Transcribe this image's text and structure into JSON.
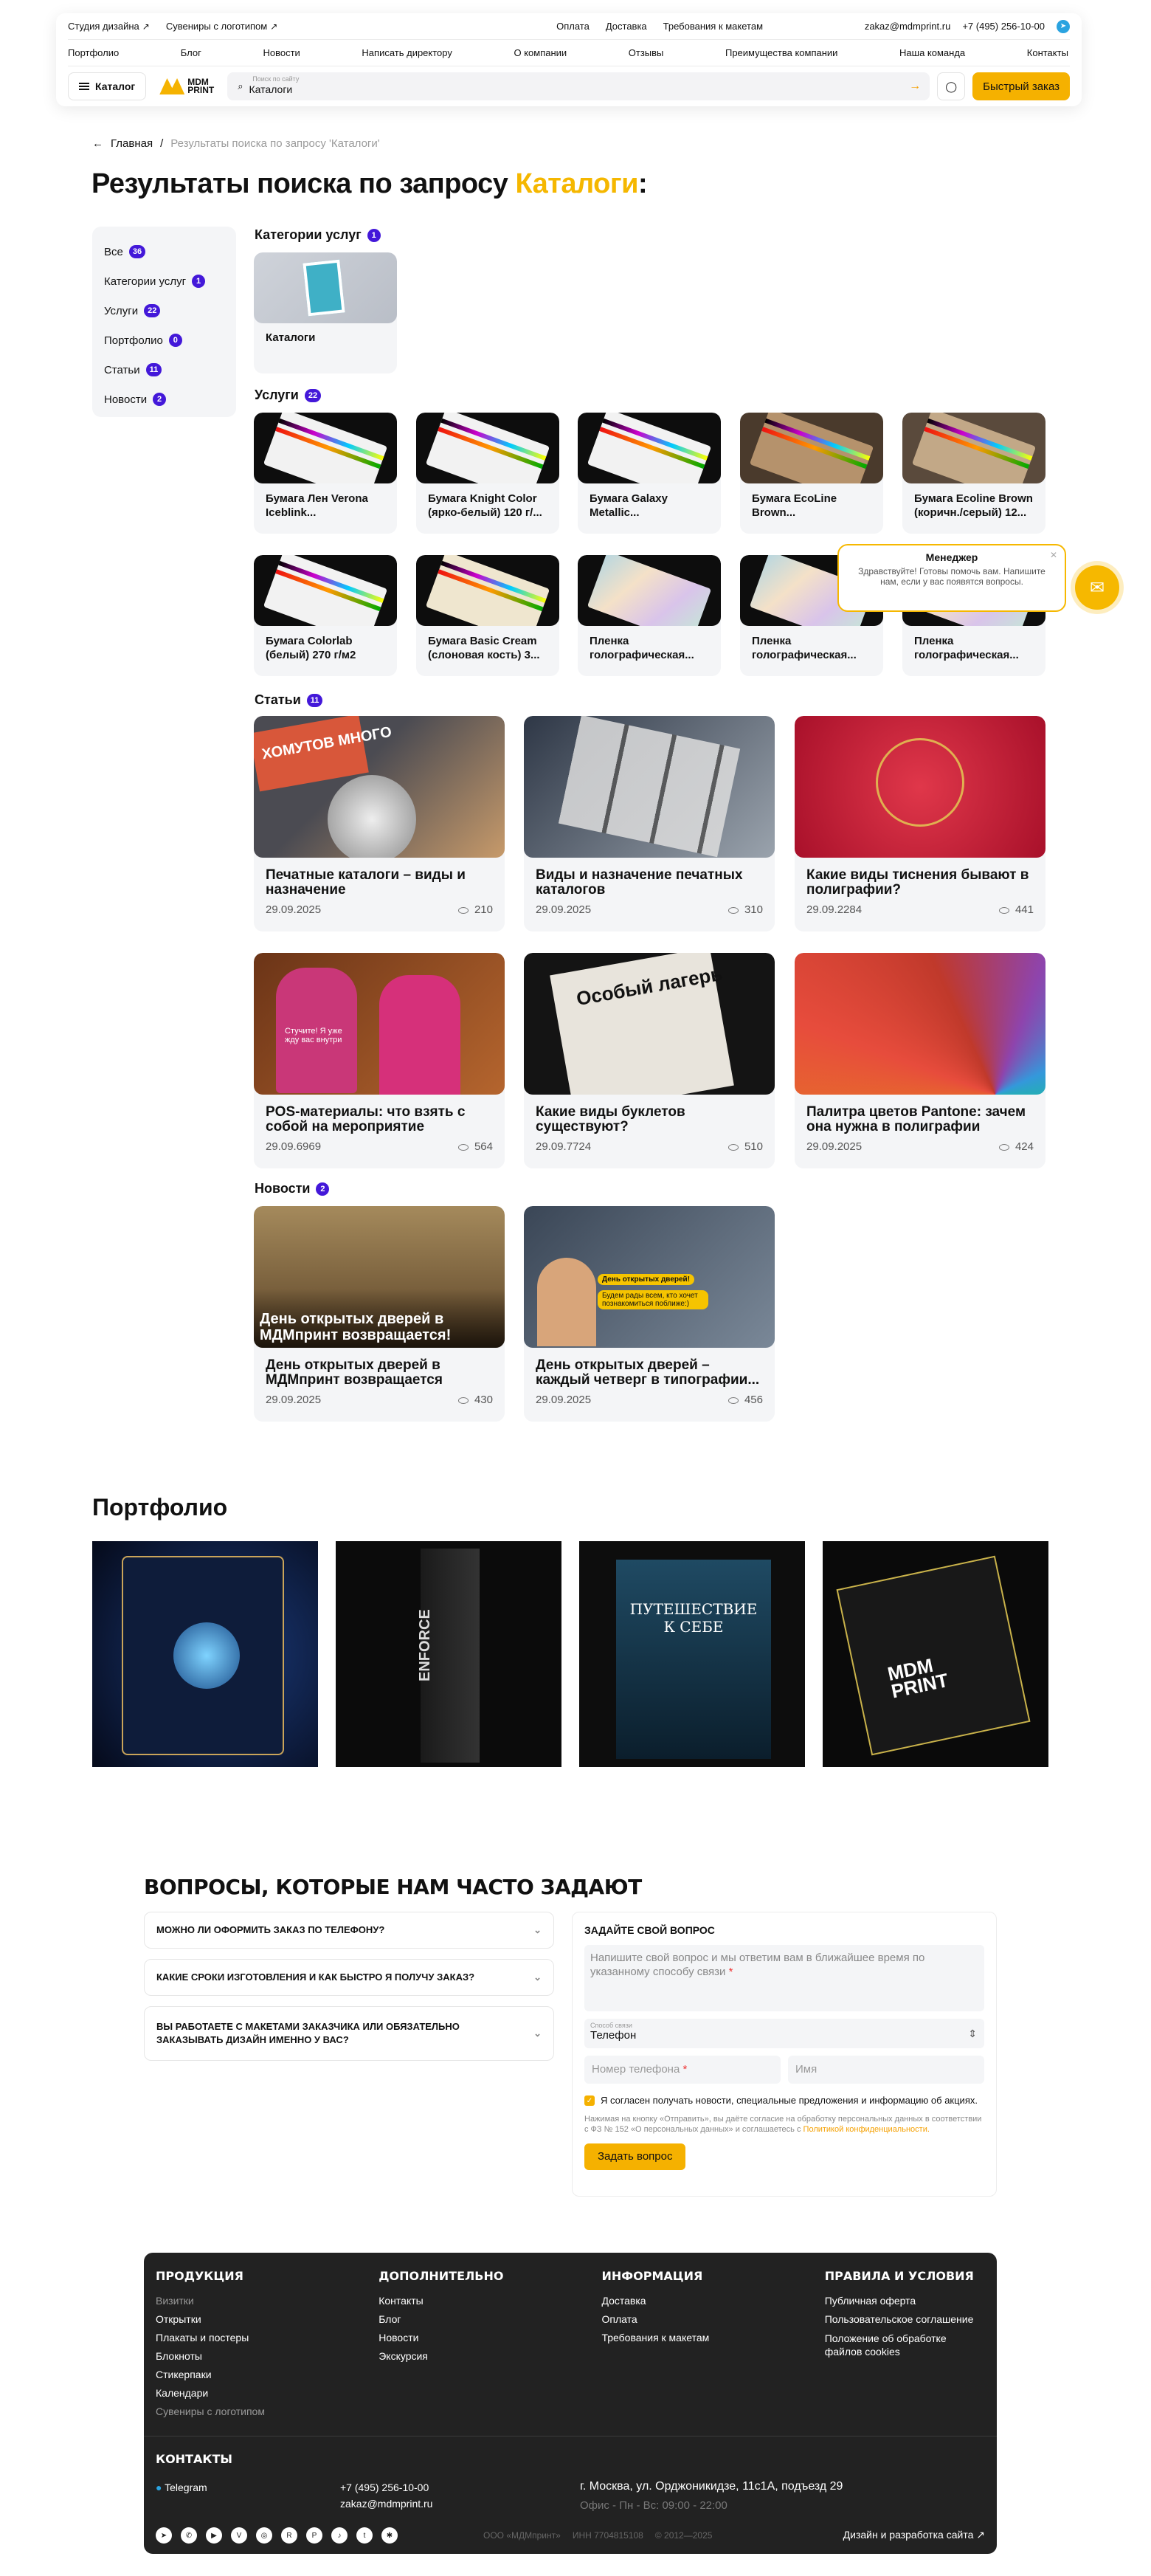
{
  "header": {
    "top_left": [
      "Студия дизайна",
      "Сувениры с логотипом"
    ],
    "top_center": [
      "Оплата",
      "Доставка",
      "Требования к макетам"
    ],
    "email": "zakaz@mdmprint.ru",
    "phone": "+7 (495) 256-10-00",
    "nav": [
      "Портфолио",
      "Блог",
      "Новости",
      "Написать директору",
      "О компании",
      "Отзывы",
      "Преимущества компании",
      "Наша команда",
      "Контакты"
    ],
    "catalog_label": "Каталог",
    "logo_text_1": "MDM",
    "logo_text_2": "PRINT",
    "search_placeholder": "Поиск по сайту",
    "search_value": "Каталоги",
    "quick_order": "Быстрый заказ"
  },
  "breadcrumbs": {
    "home": "Главная",
    "current": "Результаты поиска по запросу 'Каталоги'"
  },
  "title": {
    "prefix": "Результаты поиска по запросу ",
    "query": "Каталоги",
    "suffix": ":"
  },
  "sidebar": [
    {
      "label": "Все",
      "count": "36"
    },
    {
      "label": "Категории услуг",
      "count": "1"
    },
    {
      "label": "Услуги",
      "count": "22"
    },
    {
      "label": "Портфолио",
      "count": "0"
    },
    {
      "label": "Статьи",
      "count": "11"
    },
    {
      "label": "Новости",
      "count": "2"
    }
  ],
  "sections": {
    "categories": {
      "title": "Категории услуг",
      "count": "1",
      "items": [
        "Каталоги"
      ]
    },
    "services": {
      "title": "Услуги",
      "count": "22",
      "items": [
        "Бумага Лен Verona Iceblink...",
        "Бумага Knight Color (ярко-белый) 120 г/...",
        "Бумага Galaxy Metallic...",
        "Бумага EcoLine Brown...",
        "Бумага Ecoline Brown (коричн./серый) 12...",
        "Бумага Colorlab (белый) 270 г/м2",
        "Бумага Basic Cream (слоновая кость) 3...",
        "Пленка голографическая...",
        "Пленка голографическая...",
        "Пленка голографическая..."
      ]
    },
    "articles": {
      "title": "Статьи",
      "count": "11",
      "items": [
        {
          "title": "Печатные каталоги – виды и назначение",
          "date": "29.09.2025",
          "views": "210"
        },
        {
          "title": "Виды и назначение печатных каталогов",
          "date": "29.09.2025",
          "views": "310"
        },
        {
          "title": "Какие виды тиснения бывают в полиграфии?",
          "date": "29.09.2284",
          "views": "441"
        },
        {
          "title": "POS-материалы: что взять с собой на мероприятие",
          "date": "29.09.6969",
          "views": "564"
        },
        {
          "title": "Какие виды буклетов существуют?",
          "date": "29.09.7724",
          "views": "510"
        },
        {
          "title": "Палитра цветов Pantone: зачем она нужна в полиграфии",
          "date": "29.09.2025",
          "views": "424"
        }
      ]
    },
    "news": {
      "title": "Новости",
      "count": "2",
      "items": [
        {
          "title": "День открытых дверей в МДМпринт возвращается",
          "date": "29.09.2025",
          "views": "430",
          "overlay": "День открытых дверей в МДМпринт возвращается!"
        },
        {
          "title": "День открытых дверей – каждый четверг в типографии...",
          "date": "29.09.2025",
          "views": "456",
          "bubble1": "День открытых дверей!",
          "bubble2": "Будем рады всем, кто хочет познакомиться поближе:)"
        }
      ]
    }
  },
  "article_img_text": {
    "a1": "ХОМУТОВ МНОГО",
    "a4": "Стучите! Я уже жду вас внутри",
    "a5": "Особый лагерь"
  },
  "chat": {
    "title": "Менеджер",
    "message": "Здравствуйте! Готовы помочь вам. Напишите нам, если у вас появятся вопросы."
  },
  "portfolio": {
    "title": "Портфолио",
    "book_title": "ПУТЕШЕСТВИЕ К СЕБЕ",
    "box_text": "ENFORCE",
    "mdm1": "MDM",
    "mdm2": "PRINT"
  },
  "faq": {
    "title": "ВОПРОСЫ, КОТОРЫЕ НАМ ЧАСТО ЗАДАЮТ",
    "items": [
      "МОЖНО ЛИ ОФОРМИТЬ ЗАКАЗ ПО ТЕЛЕФОНУ?",
      "КАКИЕ СРОКИ ИЗГОТОВЛЕНИЯ И КАК БЫСТРО Я ПОЛУЧУ ЗАКАЗ?",
      "ВЫ РАБОТАЕТЕ С МАКЕТАМИ ЗАКАЗЧИКА ИЛИ ОБЯЗАТЕЛЬНО ЗАКАЗЫВАТЬ ДИЗАЙН ИМЕННО У ВАС?"
    ],
    "form": {
      "title": "ЗАДАЙТЕ СВОЙ ВОПРОС",
      "question_placeholder": "Напишите свой вопрос и мы ответим вам в ближайшее время по указанному способу связи",
      "contact_label": "Способ связи",
      "contact_value": "Телефон",
      "phone_placeholder": "Номер телефона",
      "name_placeholder": "Имя",
      "consent": "Я согласен получать новости, специальные предложения и информацию об акциях.",
      "note": "Нажимая на кнопку «Отправить», вы даёте согласие на обработку персональных данных в соответствии с ФЗ № 152 «О персональных данных» и соглашаетесь с",
      "note_link": "Политикой конфиденциальности.",
      "submit": "Задать вопрос"
    }
  },
  "footer": {
    "cols": [
      {
        "title": "ПРОДУКЦИЯ",
        "links": [
          "Визитки",
          "Открытки",
          "Плакаты и постеры",
          "Блокноты",
          "Стикерпаки",
          "Календари",
          "Сувениры с логотипом"
        ]
      },
      {
        "title": "ДОПОЛНИТЕЛЬНО",
        "links": [
          "Контакты",
          "Блог",
          "Новости",
          "Экскурсия"
        ]
      },
      {
        "title": "ИНФОРМАЦИЯ",
        "links": [
          "Доставка",
          "Оплата",
          "Требования к макетам"
        ]
      },
      {
        "title": "ПРАВИЛА И УСЛОВИЯ",
        "links": [
          "Публичная оферта",
          "Пользовательское соглашение",
          "Положение об обработке файлов cookies"
        ]
      }
    ],
    "contacts_title": "КОНТАКТЫ",
    "telegram": "Telegram",
    "phone": "+7 (495) 256-10-00",
    "email": "zakaz@mdmprint.ru",
    "address": "г. Москва, ул. Орджоникидзе, 11с1А, подъезд 29",
    "hours": "Офис - Пн - Вс: 09:00 - 22:00",
    "company": "ООО «МДМпринт»",
    "inn": "ИНН 7704815108",
    "years": "© 2012—2025",
    "dev": "Дизайн и разработка сайта"
  },
  "colors": {
    "accent": "#f5b100",
    "badge": "#4318d9",
    "card_bg": "#f4f5f7",
    "footer_bg": "#222222"
  }
}
